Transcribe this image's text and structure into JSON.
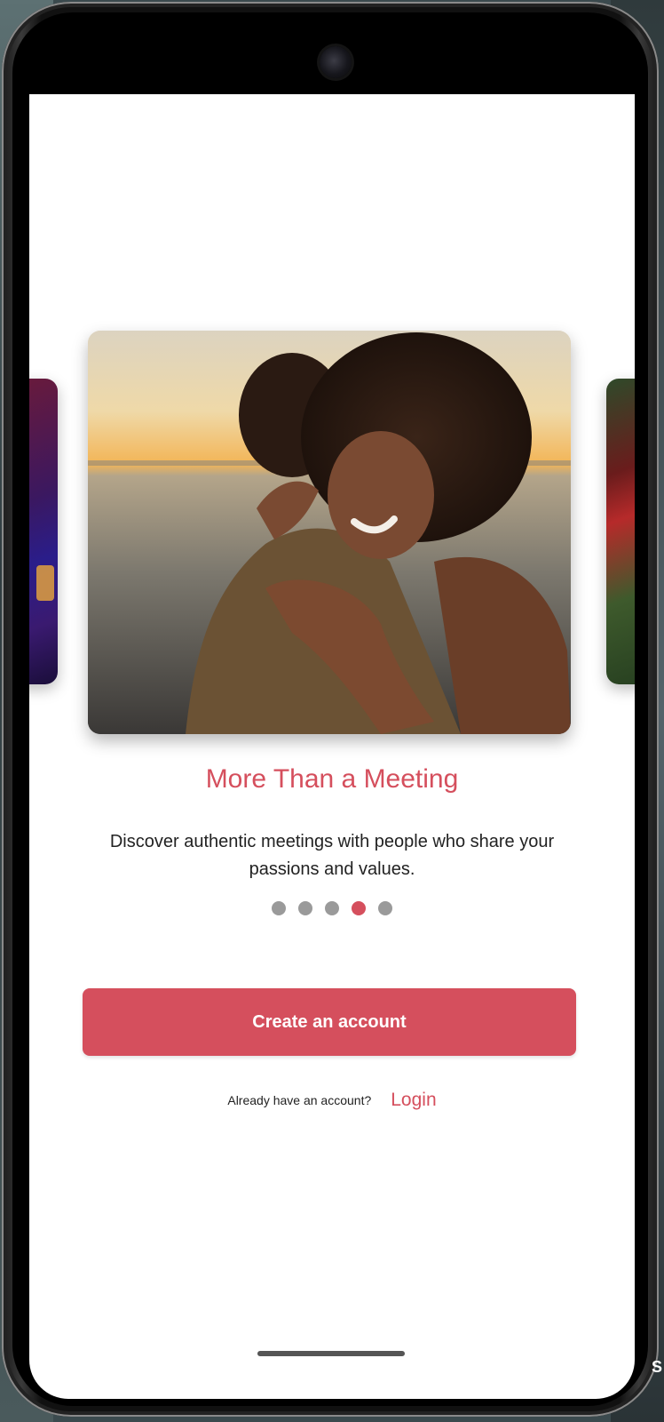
{
  "onboarding": {
    "title": "More Than a Meeting",
    "description": "Discover authentic meetings with people who share your passions and values.",
    "pagination": {
      "total": 5,
      "active_index": 3
    },
    "create_account_label": "Create an account",
    "login_hint": "Already have an account?",
    "login_label": "Login",
    "slide_image": "couple-hugging-at-sunset-photo"
  },
  "device": {
    "corner_label": "S"
  },
  "colors": {
    "accent": "#d54f5d",
    "dot_inactive": "#9a9a9a",
    "background": "#ffffff",
    "text": "#222222"
  }
}
